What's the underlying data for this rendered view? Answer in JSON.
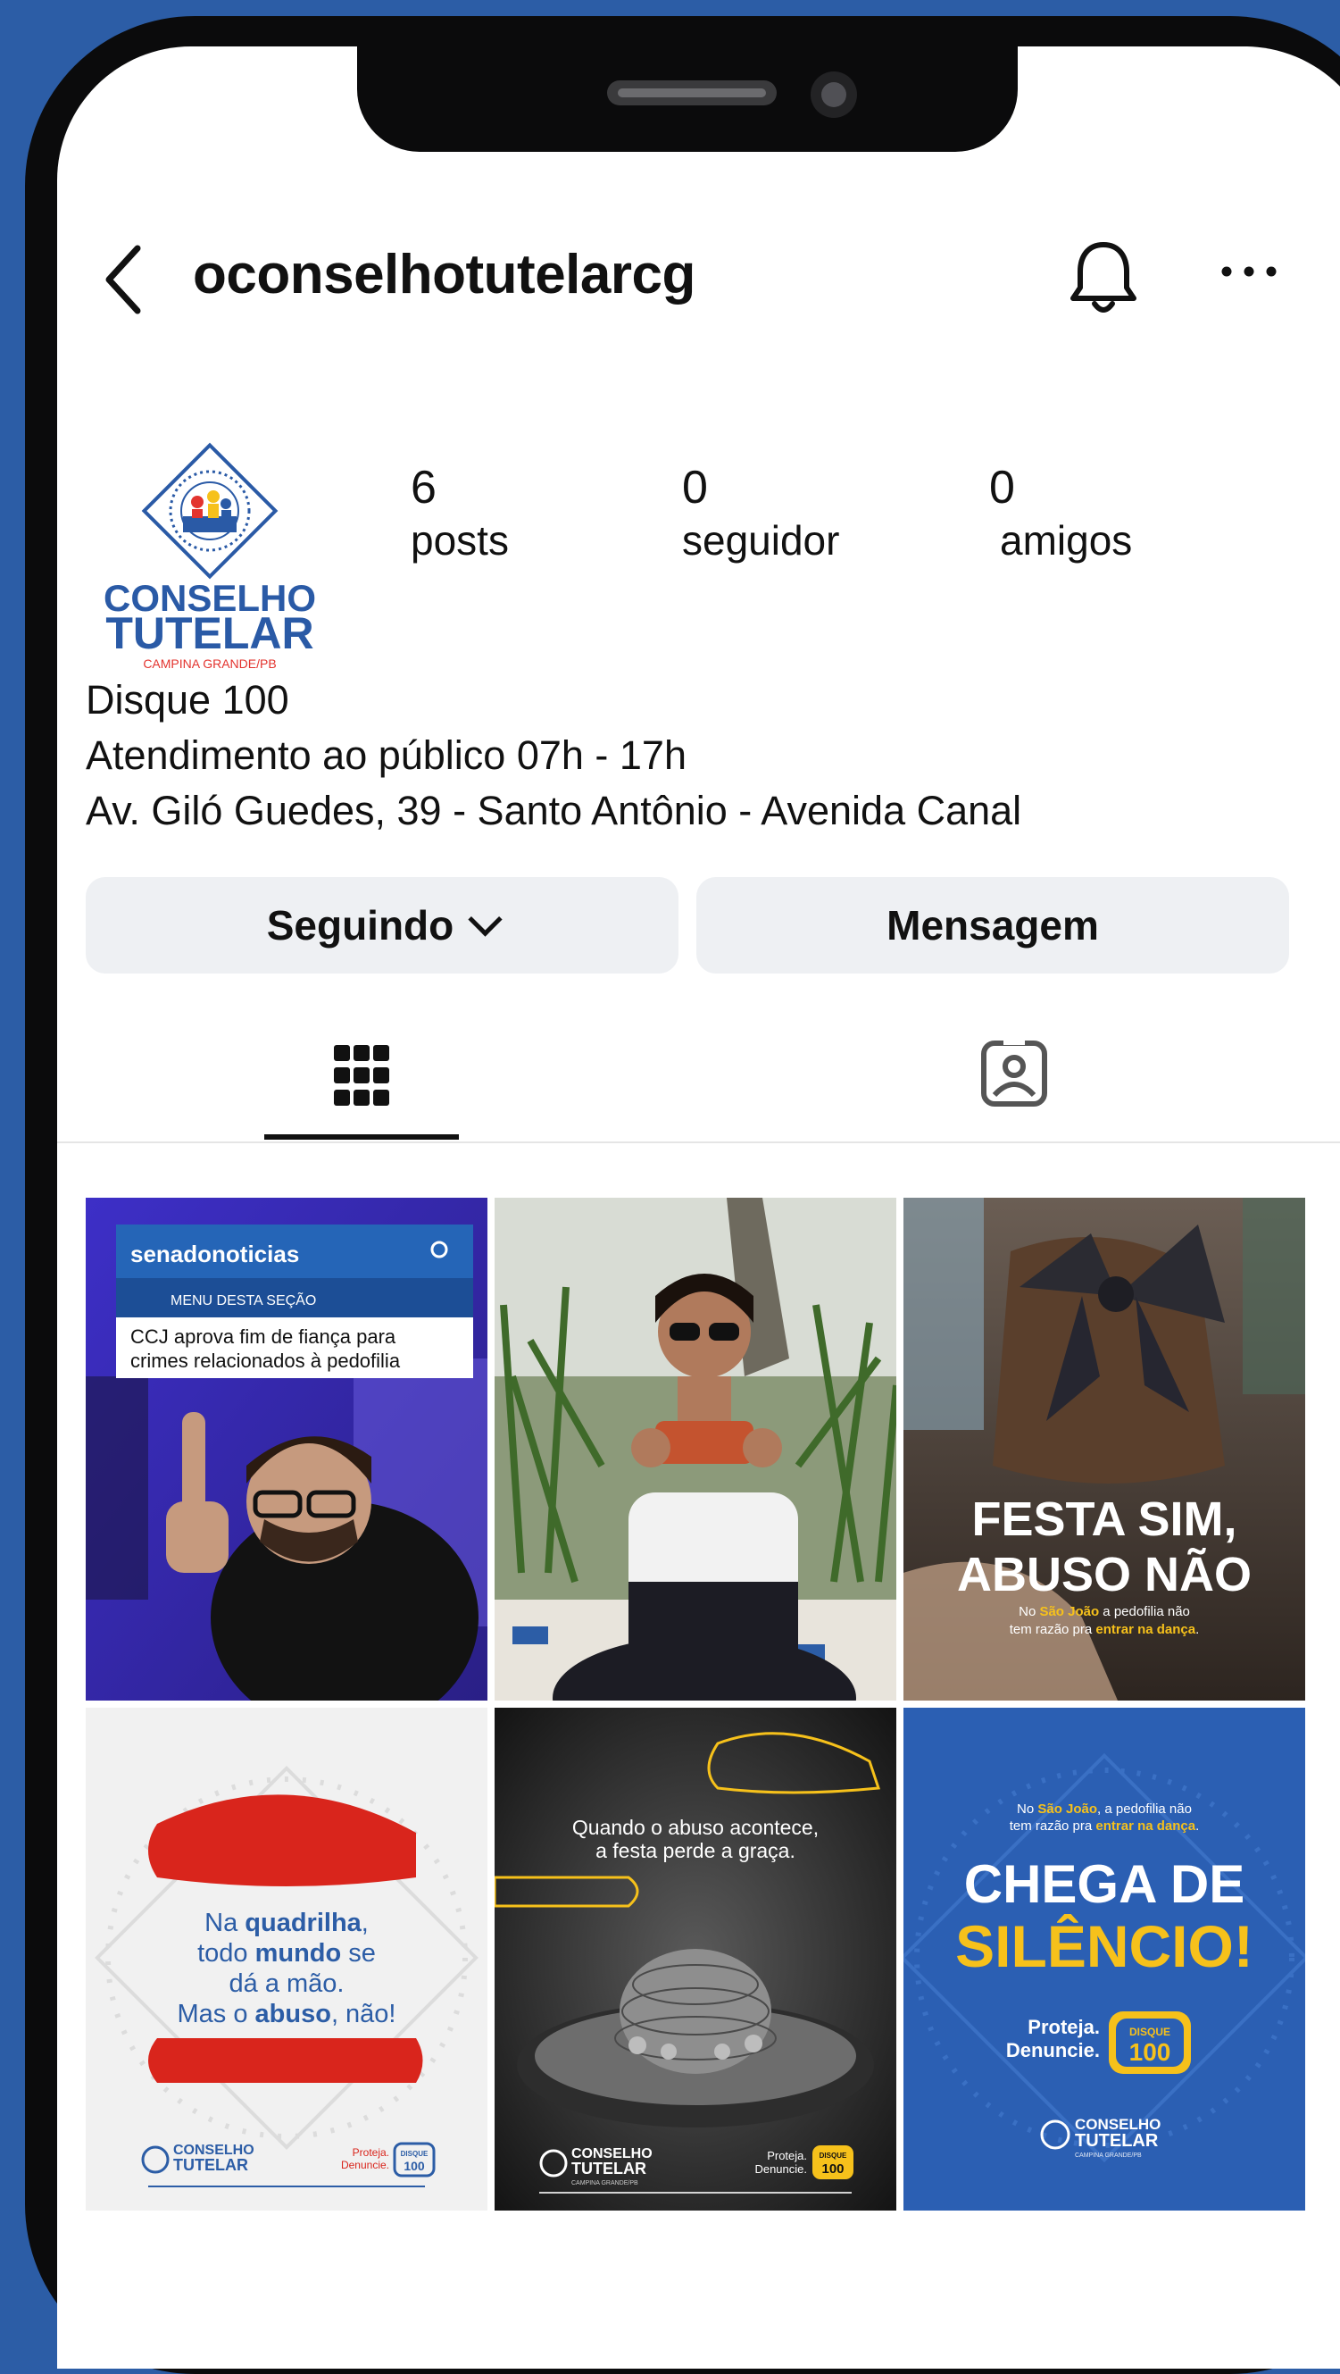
{
  "header": {
    "username": "oconselhotutelarcg"
  },
  "avatar": {
    "line1": "CONSELHO",
    "line2": "TUTELAR",
    "line3": "CAMPINA GRANDE/PB",
    "brand_blue": "#2a5aa6",
    "brand_red": "#e3342f"
  },
  "stats": {
    "posts": {
      "value": "6",
      "label": "posts"
    },
    "followers": {
      "value": "0",
      "label": "seguidor"
    },
    "friends": {
      "value": "0",
      "label": "amigos"
    }
  },
  "bio": [
    "Disque 100",
    "Atendimento ao público 07h - 17h",
    "Av. Giló Guedes, 39 - Santo Antônio - Avenida Canal"
  ],
  "buttons": {
    "following": "Seguindo",
    "message": "Mensagem"
  },
  "posts": {
    "p1": {
      "site": "senadonoticias",
      "menu": "MENU DESTA SEÇÃO",
      "headline1": "CCJ aprova fim de fiança para",
      "headline2": "crimes relacionados à pedofilia"
    },
    "p3": {
      "title1": "FESTA SIM,",
      "title2": "ABUSO NÃO",
      "sub1_a": "No ",
      "sub1_b": "São João",
      "sub1_c": " a pedofilia não",
      "sub2_a": "tem razão pra ",
      "sub2_b": "entrar na dança",
      "sub2_c": "."
    },
    "p4": {
      "l1_a": "Na ",
      "l1_b": "quadrilha",
      "l1_c": ",",
      "l2_a": "todo ",
      "l2_b": "mundo",
      "l2_c": " se",
      "l3": "dá a mão.",
      "l4_a": "Mas o ",
      "l4_b": "abuso",
      "l4_c": ", não!",
      "logo1": "CONSELHO",
      "logo2": "TUTELAR",
      "cta1": "Proteja.",
      "cta2": "Denuncie.",
      "badge1": "DISQUE",
      "badge2": "100"
    },
    "p5": {
      "l1": "Quando o abuso acontece,",
      "l2": "a festa perde a graça.",
      "logo1": "CONSELHO",
      "logo2": "TUTELAR",
      "logo3": "CAMPINA GRANDE/PB",
      "cta1": "Proteja.",
      "cta2": "Denuncie.",
      "badge1": "DISQUE",
      "badge2": "100"
    },
    "p6": {
      "sub1_a": "No ",
      "sub1_b": "São João",
      "sub1_c": ", a pedofilia não",
      "sub2_a": "tem razão pra ",
      "sub2_b": "entrar na dança",
      "sub2_c": ".",
      "title1": "CHEGA DE",
      "title2": "SILÊNCIO!",
      "cta1": "Proteja.",
      "cta2": "Denuncie.",
      "badge1": "DISQUE",
      "badge2": "100",
      "logo1": "CONSELHO",
      "logo2": "TUTELAR",
      "logo3": "CAMPINA GRANDE/PB"
    }
  },
  "colors": {
    "background": "#2c5da6",
    "button_bg": "#eef0f3",
    "accent_yellow": "#f6c11b",
    "accent_red": "#d9251c"
  }
}
